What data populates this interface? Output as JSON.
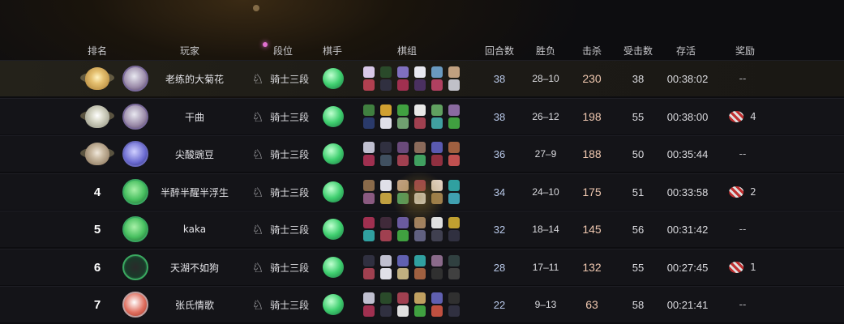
{
  "headers": {
    "rank": "排名",
    "player": "玩家",
    "tier": "段位",
    "legend": "棋手",
    "comp": "棋组",
    "rounds": "回合数",
    "wl": "胜负",
    "kills": "击杀",
    "hits": "受击数",
    "survival": "存活",
    "reward": "奖励"
  },
  "colors": {
    "row_bg": "#141418",
    "first_row_bg": "#24221a",
    "kills_text": "#f0c8b0",
    "rounds_text": "#b8c8e8"
  },
  "rows": [
    {
      "rank_display": "",
      "medal": "gold",
      "avatar": "default",
      "name": "老练的大菊花",
      "tier_icon": "knight-icon",
      "tier": "骑士三段",
      "rounds": "38",
      "wl": "28–10",
      "kills": "230",
      "hits": "38",
      "survival": "00:38:02",
      "reward": "--",
      "reward_count": "",
      "units": [
        "#d8c8e8",
        "#2a4a2a",
        "#8070c0",
        "#e8e8f0",
        "#6a9ac0",
        "#c0a080",
        "#b04050",
        "#303040",
        "#a03050",
        "#4a3060",
        "#b04060",
        "#c0c0c8"
      ]
    },
    {
      "rank_display": "",
      "medal": "silver",
      "avatar": "default",
      "name": "干曲",
      "tier_icon": "knight-icon",
      "tier": "骑士三段",
      "rounds": "38",
      "wl": "26–12",
      "kills": "198",
      "hits": "55",
      "survival": "00:38:00",
      "reward": "",
      "reward_count": "4",
      "units": [
        "#408040",
        "#d0a030",
        "#40a040",
        "#e8e8e8",
        "#60a060",
        "#8a6aa0",
        "#2a3a6a",
        "#e0e0e8",
        "#70a070",
        "#a04050",
        "#40a0a0",
        "#40a040"
      ]
    },
    {
      "rank_display": "",
      "medal": "bronze",
      "avatar": "purple",
      "name": "尖酸豌豆",
      "tier_icon": "knight-icon",
      "tier": "骑士三段",
      "rounds": "36",
      "wl": "27–9",
      "kills": "188",
      "hits": "50",
      "survival": "00:35:44",
      "reward": "--",
      "reward_count": "",
      "units": [
        "#c0c0d0",
        "#303040",
        "#6a4a7a",
        "#8a6a5a",
        "#5a5ab0",
        "#a06040",
        "#a03050",
        "#405060",
        "#a04050",
        "#40a060",
        "#903040",
        "#c05050"
      ]
    },
    {
      "rank_display": "4",
      "medal": "",
      "avatar": "green",
      "name": "半醉半醒半浮生",
      "tier_icon": "knight-icon",
      "tier": "骑士三段",
      "rounds": "34",
      "wl": "24–10",
      "kills": "175",
      "hits": "51",
      "survival": "00:33:58",
      "reward": "",
      "reward_count": "2",
      "units": [
        "#8a6a4a",
        "#e0e0e8",
        "#c0a080",
        "#a04050",
        "#e0d0c0",
        "#30a0a0",
        "#8a5a80",
        "#c0a040",
        "#50a060",
        "#e0e0e8",
        "#a08050",
        "#40a0b0"
      ]
    },
    {
      "rank_display": "5",
      "medal": "",
      "avatar": "green",
      "name": "kaka",
      "tier_icon": "knight-icon",
      "tier": "骑士三段",
      "rounds": "32",
      "wl": "18–14",
      "kills": "145",
      "hits": "56",
      "survival": "00:31:42",
      "reward": "--",
      "reward_count": "",
      "units": [
        "#a03050",
        "#402a3a",
        "#6a5aa0",
        "#a08060",
        "#e0e0e0",
        "#c0a030",
        "#30a0a0",
        "#a04050",
        "#40a040",
        "#606080",
        "#404050",
        "#303040"
      ]
    },
    {
      "rank_display": "6",
      "medal": "",
      "avatar": "dark",
      "name": "天湖不如狗",
      "tier_icon": "knight-icon",
      "tier": "骑士三段",
      "rounds": "28",
      "wl": "17–11",
      "kills": "132",
      "hits": "55",
      "survival": "00:27:45",
      "reward": "",
      "reward_count": "1",
      "units": [
        "#303040",
        "#c0c0d0",
        "#6060b0",
        "#30a0a0",
        "#8a6a8a",
        "#304040",
        "#a04050",
        "#e0e0e8",
        "#c0b080",
        "#a06040",
        "#303030",
        "#404040"
      ]
    },
    {
      "rank_display": "7",
      "medal": "",
      "avatar": "red",
      "name": "张氏情歌",
      "tier_icon": "knight-icon",
      "tier": "骑士三段",
      "rounds": "22",
      "wl": "9–13",
      "kills": "63",
      "hits": "58",
      "survival": "00:21:41",
      "reward": "--",
      "reward_count": "",
      "units": [
        "#c0c0d0",
        "#2a4a2a",
        "#a04050",
        "#c0a060",
        "#6060b0",
        "#303030",
        "#a03050",
        "#303040",
        "#e0e0e0",
        "#40a040",
        "#c05040",
        "#303040"
      ]
    }
  ]
}
